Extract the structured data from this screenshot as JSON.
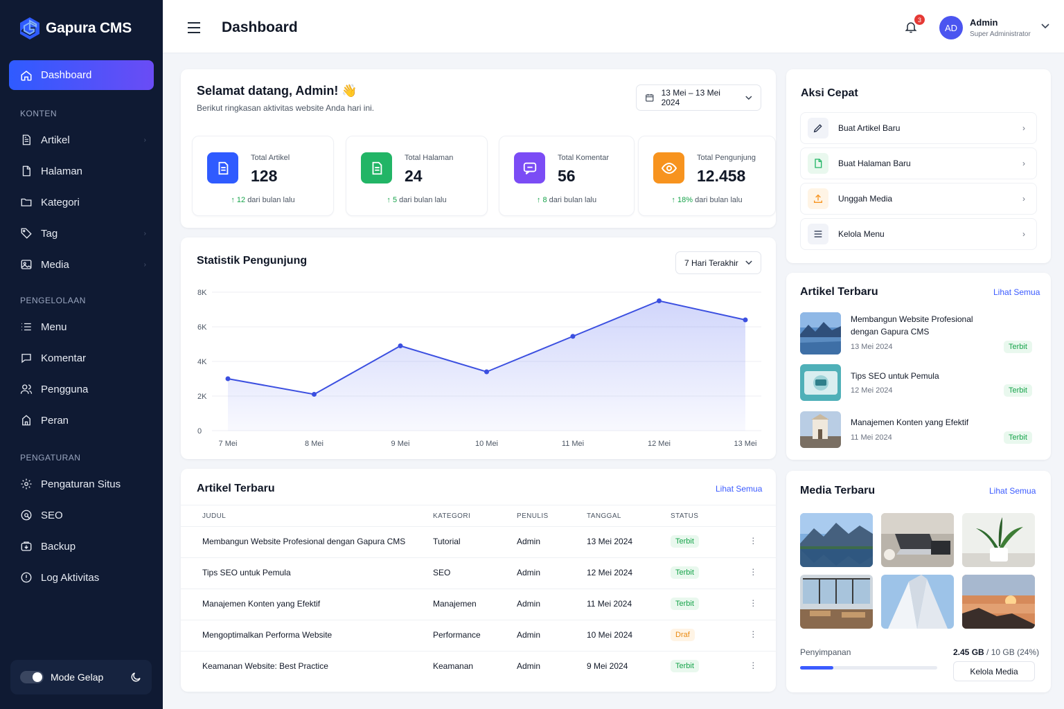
{
  "brand": {
    "name": "Gapura CMS",
    "accent": "#3b5bff"
  },
  "sidebar": {
    "active": {
      "label": "Dashboard",
      "icon": "home-icon"
    },
    "sections": [
      {
        "title": "KONTEN",
        "items": [
          {
            "label": "Artikel",
            "icon": "file-text-icon"
          },
          {
            "label": "Halaman",
            "icon": "file-icon"
          },
          {
            "label": "Kategori",
            "icon": "folder-icon"
          },
          {
            "label": "Tag",
            "icon": "tag-icon"
          },
          {
            "label": "Media",
            "icon": "image-icon"
          }
        ]
      },
      {
        "title": "PENGELOLAAN",
        "items": [
          {
            "label": "Menu",
            "icon": "list-icon"
          },
          {
            "label": "Komentar",
            "icon": "comment-icon"
          },
          {
            "label": "Pengguna",
            "icon": "users-icon"
          },
          {
            "label": "Peran",
            "icon": "shield-icon"
          }
        ]
      },
      {
        "title": "PENGATURAN",
        "items": [
          {
            "label": "Pengaturan Situs",
            "icon": "gear-icon"
          },
          {
            "label": "SEO",
            "icon": "search-icon"
          },
          {
            "label": "Backup",
            "icon": "backup-icon"
          },
          {
            "label": "Log Aktivitas",
            "icon": "info-icon"
          }
        ]
      }
    ],
    "mode_label": "Mode Gelap"
  },
  "header": {
    "title": "Dashboard",
    "notification_count": "3",
    "user": {
      "initials": "AD",
      "name": "Admin",
      "role": "Super Administrator"
    }
  },
  "welcome": {
    "title": "Selamat datang, Admin! 👋",
    "subtitle": "Berikut ringkasan aktivitas website Anda hari ini.",
    "date_range": "13 Mei – 13 Mei 2024"
  },
  "stats": [
    {
      "label": "Total Artikel",
      "value": "128",
      "delta": "12",
      "suffix": "dari bulan lalu",
      "color": "#2f5bff",
      "icon": "document-icon"
    },
    {
      "label": "Total Halaman",
      "value": "24",
      "delta": "5",
      "suffix": "dari bulan lalu",
      "color": "#22b566",
      "icon": "page-icon"
    },
    {
      "label": "Total Komentar",
      "value": "56",
      "delta": "8",
      "suffix": "dari bulan lalu",
      "color": "#7b4cf5",
      "icon": "chat-icon"
    },
    {
      "label": "Total Pengunjung",
      "value": "12.458",
      "delta": "18%",
      "suffix": "dari bulan lalu",
      "color": "#f7931e",
      "icon": "eye-icon"
    }
  ],
  "visitor_chart": {
    "title": "Statistik Pengunjung",
    "range_label": "7 Hari Terakhir"
  },
  "chart_data": {
    "type": "area",
    "title": "Statistik Pengunjung",
    "x": [
      "7 Mei",
      "8 Mei",
      "9 Mei",
      "10 Mei",
      "11 Mei",
      "12 Mei",
      "13 Mei"
    ],
    "values": [
      3000,
      2100,
      4900,
      3400,
      5450,
      7500,
      6400
    ],
    "ylim": [
      0,
      8000
    ],
    "yticks": [
      "0",
      "2K",
      "4K",
      "6K",
      "8K"
    ],
    "grid": true,
    "color": "#3b4fe0"
  },
  "quick_actions": {
    "title": "Aksi Cepat",
    "items": [
      {
        "label": "Buat Artikel Baru",
        "icon": "pencil-icon",
        "color": "#1f2a44"
      },
      {
        "label": "Buat Halaman Baru",
        "icon": "page-plus-icon",
        "color": "#22b566"
      },
      {
        "label": "Unggah Media",
        "icon": "upload-icon",
        "color": "#f7931e"
      },
      {
        "label": "Kelola Menu",
        "icon": "menu-icon",
        "color": "#1f2a44"
      }
    ]
  },
  "recent_articles_side": {
    "title": "Artikel Terbaru",
    "link": "Lihat Semua",
    "items": [
      {
        "title": "Membangun Website Profesional dengan Gapura CMS",
        "date": "13 Mei 2024",
        "status": "Terbit"
      },
      {
        "title": "Tips SEO untuk Pemula",
        "date": "12 Mei 2024",
        "status": "Terbit"
      },
      {
        "title": "Manajemen Konten yang Efektif",
        "date": "11 Mei 2024",
        "status": "Terbit"
      }
    ]
  },
  "articles_table": {
    "title": "Artikel Terbaru",
    "link": "Lihat Semua",
    "columns": [
      "JUDUL",
      "KATEGORI",
      "PENULIS",
      "TANGGAL",
      "STATUS"
    ],
    "rows": [
      {
        "judul": "Membangun Website Profesional dengan Gapura CMS",
        "kategori": "Tutorial",
        "penulis": "Admin",
        "tanggal": "13 Mei 2024",
        "status": "Terbit"
      },
      {
        "judul": "Tips SEO untuk Pemula",
        "kategori": "SEO",
        "penulis": "Admin",
        "tanggal": "12 Mei 2024",
        "status": "Terbit"
      },
      {
        "judul": "Manajemen Konten yang Efektif",
        "kategori": "Manajemen",
        "penulis": "Admin",
        "tanggal": "11 Mei 2024",
        "status": "Terbit"
      },
      {
        "judul": "Mengoptimalkan Performa Website",
        "kategori": "Performance",
        "penulis": "Admin",
        "tanggal": "10 Mei 2024",
        "status": "Draf"
      },
      {
        "judul": "Keamanan Website: Best Practice",
        "kategori": "Keamanan",
        "penulis": "Admin",
        "tanggal": "9 Mei 2024",
        "status": "Terbit"
      }
    ]
  },
  "media": {
    "title": "Media Terbaru",
    "link": "Lihat Semua",
    "storage_label": "Penyimpanan",
    "storage_used": "2.45 GB",
    "storage_total": "/ 10 GB (24%)",
    "storage_fraction": 0.24,
    "button": "Kelola Media"
  }
}
